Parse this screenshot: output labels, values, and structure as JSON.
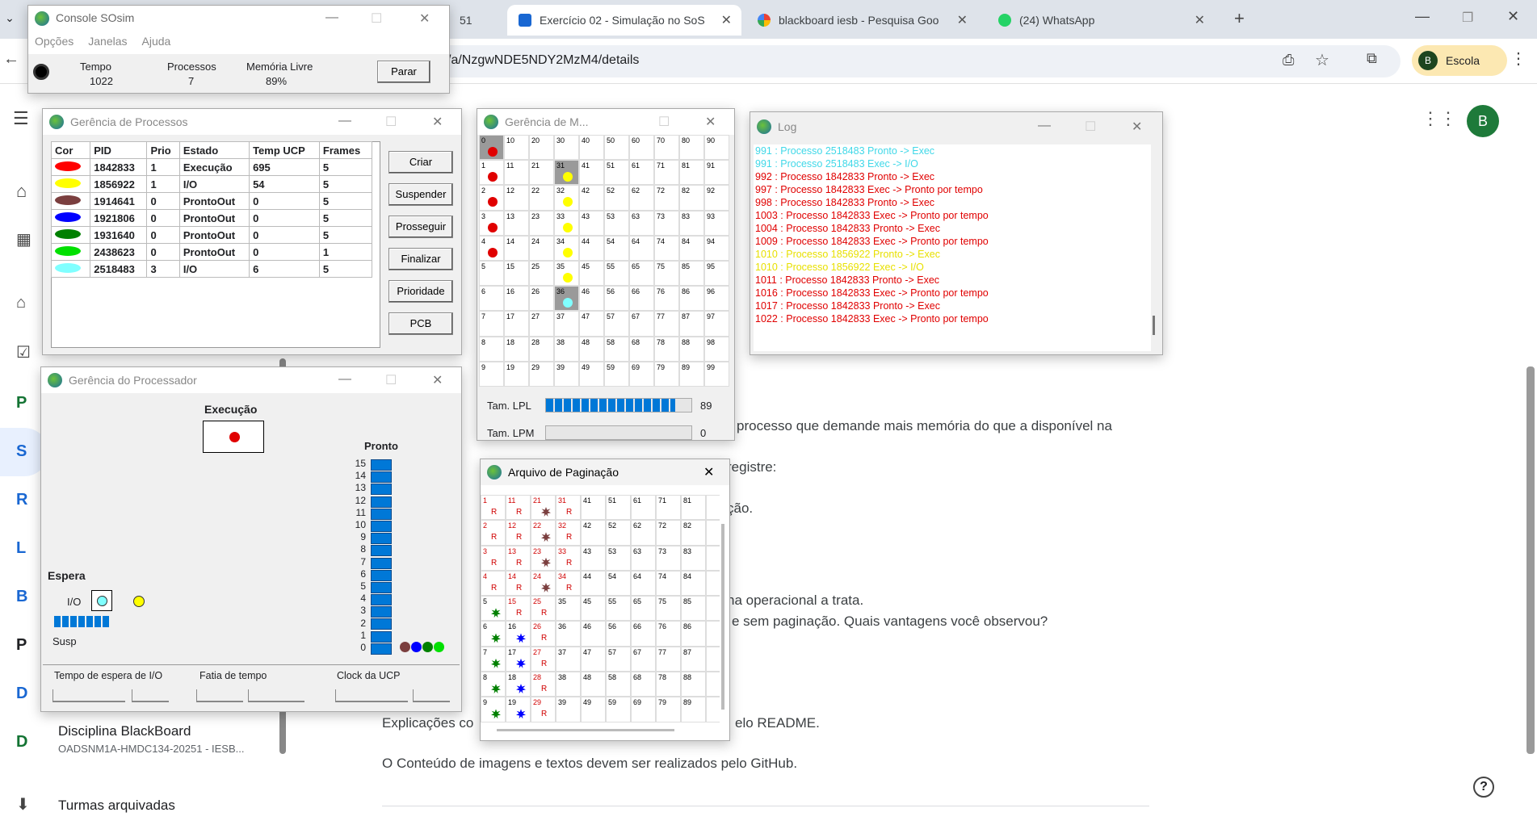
{
  "browser": {
    "tabs": [
      {
        "label": "51",
        "active": false
      },
      {
        "label": "Exercício 02 - Simulação no SoS",
        "active": true
      },
      {
        "label": "blackboard iesb - Pesquisa Goo",
        "active": false
      },
      {
        "label": "(24) WhatsApp",
        "active": false
      }
    ],
    "url": "/a/NzgwNDE5NDY2MzM4/details",
    "profile_label": "Escola",
    "profile_initial": "B",
    "account_initial": "B"
  },
  "classroom": {
    "sidebar_letters": [
      "P",
      "S",
      "R",
      "L",
      "B",
      "P",
      "D",
      "D"
    ],
    "sidebar_course_title": "Disciplina BlackBoard",
    "sidebar_course_sub": "OADSNM1A-HMDC134-20251 - IESB...",
    "archived_label": "Turmas arquivadas",
    "content_lines": [
      "processo que demande mais memória do que a disponível na",
      "registre:",
      "ção.",
      "na operacional a trata.",
      "e sem paginação. Quais vantagens você observou?",
      "Explicações co",
      "elo README.",
      "O Conteúdo de imagens e textos devem ser realizados pelo GitHub."
    ]
  },
  "console": {
    "title": "Console SOsim",
    "menu": [
      "Opções",
      "Janelas",
      "Ajuda"
    ],
    "tempo_label": "Tempo",
    "tempo_value": "1022",
    "processos_label": "Processos",
    "processos_value": "7",
    "memoria_label": "Memória Livre",
    "memoria_value": "89%",
    "stop_button": "Parar"
  },
  "processes": {
    "title": "Gerência de Processos",
    "headers": [
      "Cor",
      "PID",
      "Prio",
      "Estado",
      "Temp UCP",
      "Frames"
    ],
    "rows": [
      {
        "color": "#ff0000",
        "pid": "1842833",
        "prio": "1",
        "estado": "Execução",
        "ucp": "695",
        "frames": "5"
      },
      {
        "color": "#ffff00",
        "pid": "1856922",
        "prio": "1",
        "estado": "I/O",
        "ucp": "54",
        "frames": "5"
      },
      {
        "color": "#7b3f3f",
        "pid": "1914641",
        "prio": "0",
        "estado": "ProntoOut",
        "ucp": "0",
        "frames": "5"
      },
      {
        "color": "#0000ff",
        "pid": "1921806",
        "prio": "0",
        "estado": "ProntoOut",
        "ucp": "0",
        "frames": "5"
      },
      {
        "color": "#008000",
        "pid": "1931640",
        "prio": "0",
        "estado": "ProntoOut",
        "ucp": "0",
        "frames": "5"
      },
      {
        "color": "#00e000",
        "pid": "2438623",
        "prio": "0",
        "estado": "ProntoOut",
        "ucp": "0",
        "frames": "1"
      },
      {
        "color": "#80ffff",
        "pid": "2518483",
        "prio": "3",
        "estado": "I/O",
        "ucp": "6",
        "frames": "5"
      }
    ],
    "buttons": [
      "Criar",
      "Suspender",
      "Prosseguir",
      "Finalizar",
      "Prioridade",
      "PCB"
    ]
  },
  "processor": {
    "title": "Gerência do Processador",
    "exec_label": "Execução",
    "pronto_label": "Pronto",
    "espera_label": "Espera",
    "io_label": "I/O",
    "susp_label": "Susp",
    "queue_numbers": [
      "15",
      "14",
      "13",
      "12",
      "11",
      "10",
      "9",
      "8",
      "7",
      "6",
      "5",
      "4",
      "3",
      "2",
      "1",
      "0"
    ],
    "bottom_labels": [
      "Tempo de espera de I/O",
      "Fatia de tempo",
      "Clock da UCP"
    ]
  },
  "memory": {
    "title": "Gerência de M...",
    "lpl_label": "Tam. LPL",
    "lpl_value": "89",
    "lpl_fill": 0.89,
    "lpm_label": "Tam. LPM",
    "lpm_value": "0"
  },
  "paging": {
    "title": "Arquivo de Paginação"
  },
  "log": {
    "title": "Log",
    "lines": [
      {
        "text": "991 : Processo 2518483 Pronto -> Exec",
        "color": "#40d8e8"
      },
      {
        "text": "991 : Processo 2518483 Exec -> I/O",
        "color": "#40d8e8"
      },
      {
        "text": "992 : Processo 1842833 Pronto -> Exec",
        "color": "#e00000"
      },
      {
        "text": "997 : Processo 1842833 Exec -> Pronto por tempo",
        "color": "#e00000"
      },
      {
        "text": "998 : Processo 1842833 Pronto -> Exec",
        "color": "#e00000"
      },
      {
        "text": "1003 : Processo 1842833 Exec -> Pronto por tempo",
        "color": "#e00000"
      },
      {
        "text": "1004 : Processo 1842833 Pronto -> Exec",
        "color": "#e00000"
      },
      {
        "text": "1009 : Processo 1842833 Exec -> Pronto por tempo",
        "color": "#e00000"
      },
      {
        "text": "1010 : Processo 1856922 Pronto -> Exec",
        "color": "#e8e000"
      },
      {
        "text": "1010 : Processo 1856922 Exec -> I/O",
        "color": "#e8e000"
      },
      {
        "text": "1011 : Processo 1842833 Pronto -> Exec",
        "color": "#e00000"
      },
      {
        "text": "1016 : Processo 1842833 Exec -> Pronto por tempo",
        "color": "#e00000"
      },
      {
        "text": "1017 : Processo 1842833 Pronto -> Exec",
        "color": "#e00000"
      },
      {
        "text": "1022 : Processo 1842833 Exec -> Pronto por tempo",
        "color": "#e00000"
      }
    ]
  }
}
